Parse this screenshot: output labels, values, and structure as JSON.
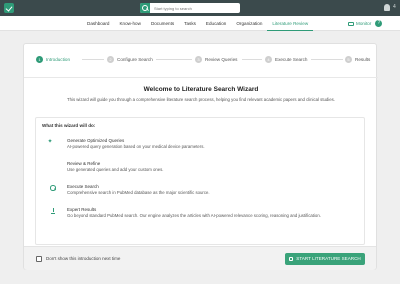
{
  "topbar": {
    "search_placeholder": "Start typing to search",
    "count": "4"
  },
  "nav": {
    "items": [
      "Dashboard",
      "Know-how",
      "Documents",
      "Tasks",
      "Education",
      "Organization",
      "Literature Review"
    ],
    "active_index": 6,
    "monitor_label": "Monitor",
    "help": "?"
  },
  "wizard": {
    "steps": [
      {
        "num": "1",
        "label": "Introduction"
      },
      {
        "num": "2",
        "label": "Configure Search"
      },
      {
        "num": "3",
        "label": "Review Queries"
      },
      {
        "num": "4",
        "label": "Execute Search"
      },
      {
        "num": "5",
        "label": "Results"
      }
    ],
    "title": "Welcome to Literature Search Wizard",
    "intro": "This wizard will guide you through a comprehensive literature search process, helping you find relevant academic papers and clinical studies.",
    "features_heading": "What this wizard will do:",
    "features": [
      {
        "icon": "sparkle-icon",
        "title": "Generate Optimized Queries",
        "desc": "AI-powered query generation based on your medical device parameters."
      },
      {
        "icon": "checkbox-icon",
        "title": "Review & Refine",
        "desc": "Use generated queries and add your custom ones."
      },
      {
        "icon": "search-icon",
        "title": "Execute Search",
        "desc": "Comprehensive search in PubMed database as the major scientific source."
      },
      {
        "icon": "export-icon",
        "title": "Expert Results",
        "desc": "Go beyond standard PubMed search. Our engine analyzes the articles with AI-powered relevance scoring, reasoning and justification."
      }
    ],
    "dont_show_label": "Don't show this introduction next time",
    "start_button": "START LITERATURE SEARCH"
  },
  "colors": {
    "accent": "#2f9b78",
    "topbar": "#3b4a4c",
    "button": "#3aa37a"
  }
}
